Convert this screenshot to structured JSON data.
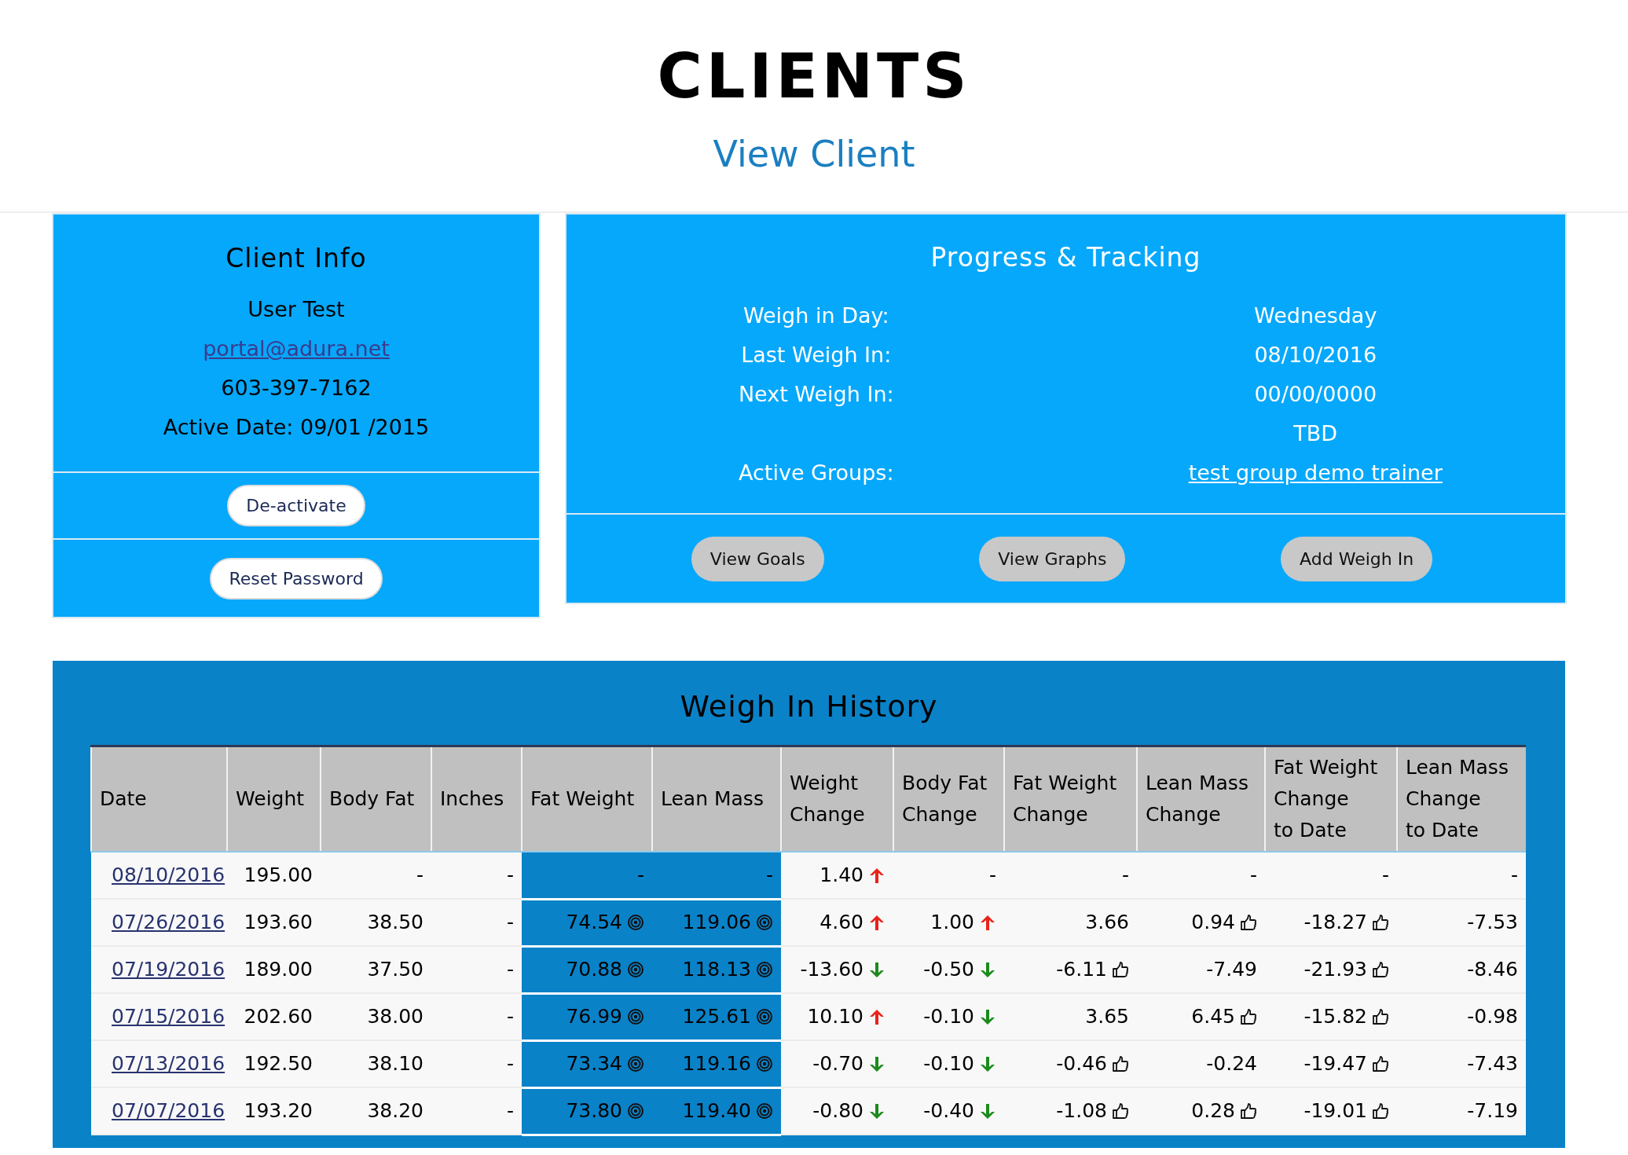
{
  "page": {
    "title": "CLIENTS",
    "subtitle": "View Client"
  },
  "client_info": {
    "title": "Client Info",
    "name": "User Test",
    "email": "portal@adura.net",
    "phone": "603-397-7162",
    "active_date": "Active Date: 09/01 /2015",
    "buttons": [
      "De-activate",
      "Reset Password"
    ]
  },
  "progress": {
    "title": "Progress & Tracking",
    "rows": [
      {
        "label": "Weigh in Day:",
        "value": "Wednesday",
        "kind": "text"
      },
      {
        "label": "Last Weigh In:",
        "value": "08/10/2016",
        "kind": "text"
      },
      {
        "label": "Next Weigh In:",
        "value": "00/00/0000",
        "kind": "text"
      },
      {
        "value": "TBD",
        "kind": "text"
      },
      {
        "label": "Active Groups:",
        "value": "test group demo trainer",
        "kind": "link"
      }
    ],
    "buttons": [
      "View Goals",
      "View Graphs",
      "Add Weigh In"
    ]
  },
  "history": {
    "title": "Weigh In History",
    "columns": [
      {
        "lines": [
          "Date"
        ],
        "highlight": false
      },
      {
        "lines": [
          "Weight"
        ],
        "highlight": false
      },
      {
        "lines": [
          "Body Fat"
        ],
        "highlight": false
      },
      {
        "lines": [
          "Inches"
        ],
        "highlight": false
      },
      {
        "lines": [
          "Fat Weight"
        ],
        "highlight": true
      },
      {
        "lines": [
          "Lean Mass"
        ],
        "highlight": true
      },
      {
        "lines": [
          "Weight",
          "Change"
        ],
        "highlight": false
      },
      {
        "lines": [
          "Body Fat",
          "Change"
        ],
        "highlight": false
      },
      {
        "lines": [
          "Fat Weight",
          "Change"
        ],
        "highlight": false
      },
      {
        "lines": [
          "Lean Mass",
          "Change"
        ],
        "highlight": false
      },
      {
        "lines": [
          "Fat Weight",
          "Change",
          "to Date"
        ],
        "highlight": false
      },
      {
        "lines": [
          "Lean Mass",
          "Change",
          "to Date"
        ],
        "highlight": false
      }
    ],
    "rows": [
      {
        "cells": [
          {
            "text": "08/10/2016",
            "kind": "link"
          },
          {
            "text": "195.00"
          },
          {
            "text": "-"
          },
          {
            "text": "-"
          },
          {
            "text": "-"
          },
          {
            "text": "-"
          },
          {
            "text": "1.40",
            "kind": "rise"
          },
          {
            "text": "-"
          },
          {
            "text": "-"
          },
          {
            "text": "-"
          },
          {
            "text": "-"
          },
          {
            "text": "-"
          }
        ]
      },
      {
        "cells": [
          {
            "text": "07/26/2016",
            "kind": "link"
          },
          {
            "text": "193.60"
          },
          {
            "text": "38.50"
          },
          {
            "text": "-"
          },
          {
            "text": "74.54",
            "kind": "goal"
          },
          {
            "text": "119.06",
            "kind": "goal"
          },
          {
            "text": "4.60",
            "kind": "rise"
          },
          {
            "text": "1.00",
            "kind": "rise"
          },
          {
            "text": "3.66"
          },
          {
            "text": "0.94",
            "kind": "approved"
          },
          {
            "text": "-18.27",
            "kind": "approved"
          },
          {
            "text": "-7.53"
          }
        ]
      },
      {
        "cells": [
          {
            "text": "07/19/2016",
            "kind": "link"
          },
          {
            "text": "189.00"
          },
          {
            "text": "37.50"
          },
          {
            "text": "-"
          },
          {
            "text": "70.88",
            "kind": "goal"
          },
          {
            "text": "118.13",
            "kind": "goal"
          },
          {
            "text": "-13.60",
            "kind": "fall"
          },
          {
            "text": "-0.50",
            "kind": "fall"
          },
          {
            "text": "-6.11",
            "kind": "approved"
          },
          {
            "text": "-7.49"
          },
          {
            "text": "-21.93",
            "kind": "approved"
          },
          {
            "text": "-8.46"
          }
        ]
      },
      {
        "cells": [
          {
            "text": "07/15/2016",
            "kind": "link"
          },
          {
            "text": "202.60"
          },
          {
            "text": "38.00"
          },
          {
            "text": "-"
          },
          {
            "text": "76.99",
            "kind": "goal"
          },
          {
            "text": "125.61",
            "kind": "goal"
          },
          {
            "text": "10.10",
            "kind": "rise"
          },
          {
            "text": "-0.10",
            "kind": "fall"
          },
          {
            "text": "3.65"
          },
          {
            "text": "6.45",
            "kind": "approved"
          },
          {
            "text": "-15.82",
            "kind": "approved"
          },
          {
            "text": "-0.98"
          }
        ]
      },
      {
        "cells": [
          {
            "text": "07/13/2016",
            "kind": "link"
          },
          {
            "text": "192.50"
          },
          {
            "text": "38.10"
          },
          {
            "text": "-"
          },
          {
            "text": "73.34",
            "kind": "goal"
          },
          {
            "text": "119.16",
            "kind": "goal"
          },
          {
            "text": "-0.70",
            "kind": "fall"
          },
          {
            "text": "-0.10",
            "kind": "fall"
          },
          {
            "text": "-0.46",
            "kind": "approved"
          },
          {
            "text": "-0.24"
          },
          {
            "text": "-19.47",
            "kind": "approved"
          },
          {
            "text": "-7.43"
          }
        ]
      },
      {
        "cells": [
          {
            "text": "07/07/2016",
            "kind": "link"
          },
          {
            "text": "193.20"
          },
          {
            "text": "38.20"
          },
          {
            "text": "-"
          },
          {
            "text": "73.80",
            "kind": "goal"
          },
          {
            "text": "119.40",
            "kind": "goal"
          },
          {
            "text": "-0.80",
            "kind": "fall"
          },
          {
            "text": "-0.40",
            "kind": "fall"
          },
          {
            "text": "-1.08",
            "kind": "approved"
          },
          {
            "text": "0.28",
            "kind": "approved"
          },
          {
            "text": "-19.01",
            "kind": "approved"
          },
          {
            "text": "-7.19"
          }
        ]
      }
    ]
  }
}
